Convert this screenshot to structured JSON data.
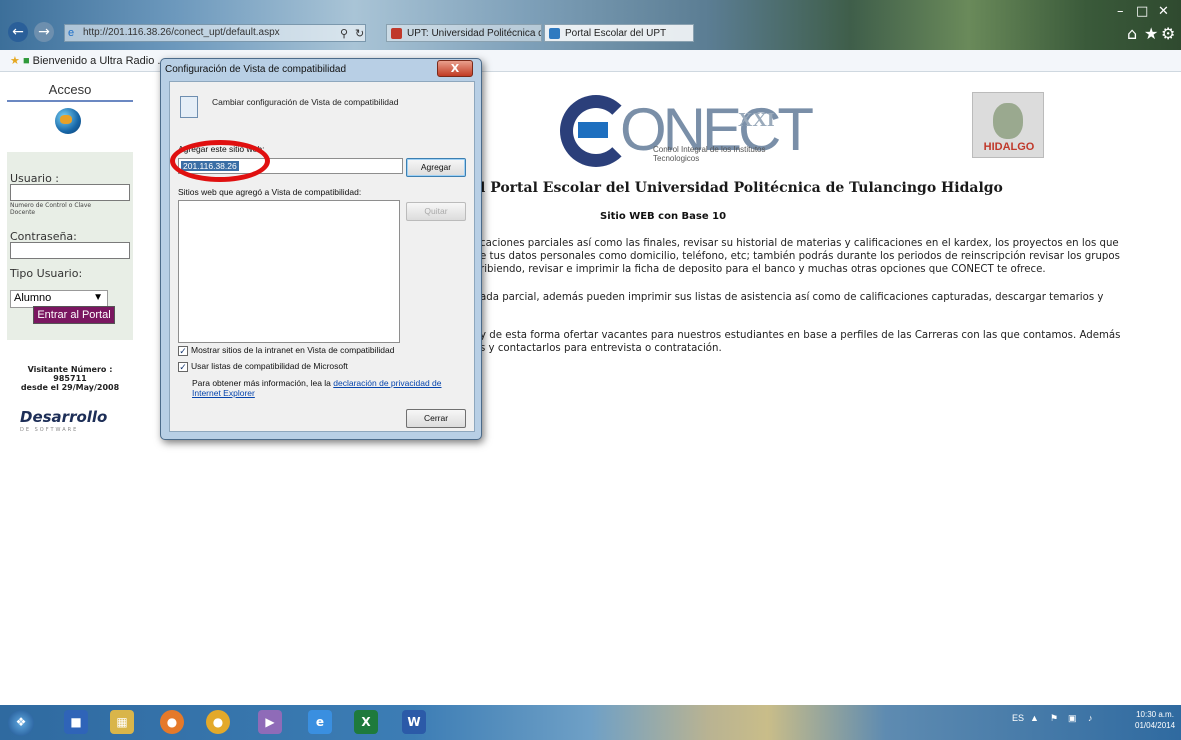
{
  "browser": {
    "address": "http://201.116.38.26/conect_upt/default.aspx",
    "tabs": [
      {
        "label": "UPT: Universidad Politécnica d..."
      },
      {
        "label": "Portal Escolar del UPT"
      }
    ],
    "favorites_item": "Bienvenido a Ultra Radio ..."
  },
  "sidebar": {
    "title": "Acceso",
    "user_label": "Usuario :",
    "user_hint": "Numero de Control o Clave Docente",
    "password_label": "Contraseña:",
    "type_label": "Tipo Usuario:",
    "type_value": "Alumno",
    "enter_button": "Entrar al Portal",
    "visitor_line1": "Visitante Número :",
    "visitor_count": "985711",
    "visitor_since": "desde el 29/May/2008",
    "dev_logo": "Desarrollo",
    "dev_sub": "DE SOFTWARE"
  },
  "main": {
    "logo_word": "ONECT",
    "logo_xxi": "XXI",
    "logo_sub": "Control Integral de los Institutos Tecnologicos",
    "crest_label": "HIDALGO",
    "title": "l Portal Escolar del Universidad Politécnica de Tulancingo Hidalgo",
    "subtitle": "Sitio WEB con Base 10",
    "para1": [
      "caciones parciales así como las finales, revisar su historial de materias y calificaciones en el kardex, los proyectos en los que",
      "e tus datos personales como domicilio, teléfono, etc; también podrás durante los periodos de reinscripción revisar los grupos",
      "ribiendo, revisar e imprimir la ficha de deposito para el banco y muchas otras opciones que CONECT te ofrece."
    ],
    "para2": [
      "ada parcial, además pueden imprimir sus listas de asistencia así como de calificaciones capturadas, descargar temarios y"
    ],
    "para3": [
      "y de esta forma ofertar vacantes para nuestros estudiantes en base a perfiles de las Carreras con las que contamos. Además",
      "s y contactarlos para entrevista o contratación."
    ]
  },
  "dialog": {
    "title": "Configuración de Vista de compatibilidad",
    "close": "X",
    "header": "Cambiar configuración de Vista de compatibilidad",
    "add_label": "Agregar este sitio web:",
    "add_value": "201.116.38.26",
    "add_button": "Agregar",
    "list_label": "Sitios web que agregó a Vista de compatibilidad:",
    "remove_button": "Quitar",
    "check1": "Mostrar sitios de la intranet en Vista de compatibilidad",
    "check2": "Usar listas de compatibilidad de Microsoft",
    "info_text": "Para obtener más información, lea la",
    "info_link": "declaración de privacidad de Internet Explorer",
    "close_button": "Cerrar"
  },
  "taskbar": {
    "lang": "ES",
    "time": "10:30 a.m.",
    "date": "01/04/2014"
  }
}
